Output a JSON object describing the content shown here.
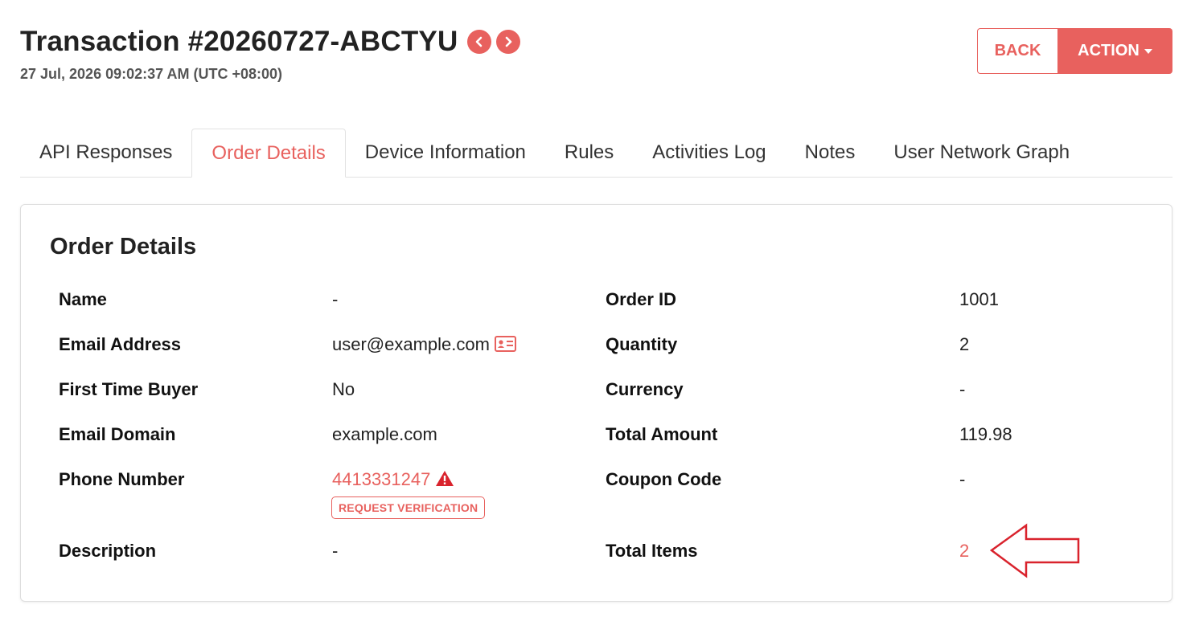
{
  "header": {
    "title": "Transaction #20260727-ABCTYU",
    "subtitle": "27 Jul, 2026 09:02:37 AM (UTC +08:00)"
  },
  "buttons": {
    "back": "BACK",
    "action": "ACTION"
  },
  "tabs": [
    {
      "label": "API Responses",
      "active": false
    },
    {
      "label": "Order Details",
      "active": true
    },
    {
      "label": "Device Information",
      "active": false
    },
    {
      "label": "Rules",
      "active": false
    },
    {
      "label": "Activities Log",
      "active": false
    },
    {
      "label": "Notes",
      "active": false
    },
    {
      "label": "User Network Graph",
      "active": false
    }
  ],
  "card": {
    "title": "Order Details",
    "left": [
      {
        "label": "Name",
        "value": "-"
      },
      {
        "label": "Email Address",
        "value": "user@example.com"
      },
      {
        "label": "First Time Buyer",
        "value": "No"
      },
      {
        "label": "Email Domain",
        "value": "example.com"
      },
      {
        "label": "Phone Number",
        "value": "4413331247"
      },
      {
        "label": "Description",
        "value": "-"
      }
    ],
    "right": [
      {
        "label": "Order ID",
        "value": "1001"
      },
      {
        "label": "Quantity",
        "value": "2"
      },
      {
        "label": "Currency",
        "value": "-"
      },
      {
        "label": "Total Amount",
        "value": "119.98"
      },
      {
        "label": "Coupon Code",
        "value": "-"
      },
      {
        "label": "Total Items",
        "value": "2"
      }
    ],
    "request_verification": "REQUEST VERIFICATION"
  },
  "colors": {
    "accent": "#e8615e",
    "annotation_arrow": "#d9232d"
  },
  "icons": {
    "prev": "chevron-left-icon",
    "next": "chevron-right-icon",
    "email": "id-card-icon",
    "phone_warning": "warning-triangle-icon",
    "annotation": "arrow-left-icon"
  }
}
